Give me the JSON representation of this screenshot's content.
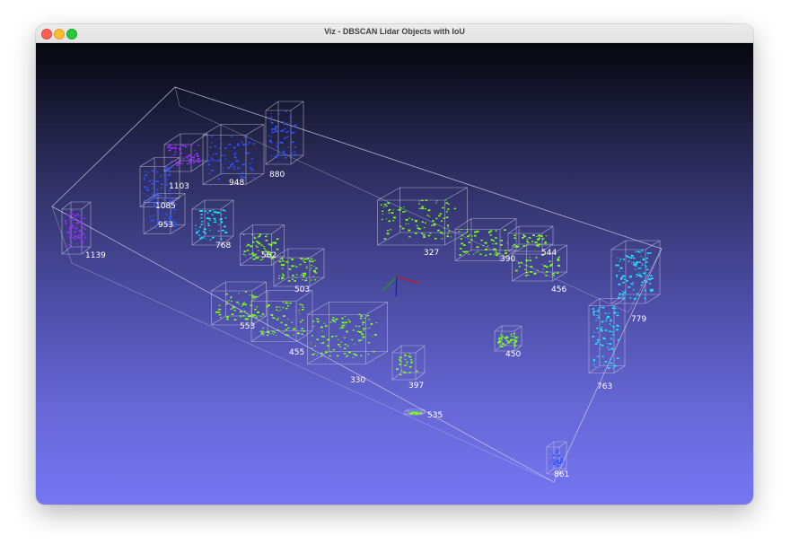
{
  "window": {
    "title": "Viz - DBSCAN Lidar Objects with IoU"
  },
  "colors": {
    "green": "#7dff1a",
    "cyan": "#1ee0ff",
    "blue": "#3050ff",
    "purple": "#9a2cff",
    "box": "#c8c8e0",
    "axis_x": "#d01818",
    "axis_y": "#18a018",
    "axis_z": "#1818d0"
  },
  "objects": [
    {
      "label": "1139",
      "color": "purple"
    },
    {
      "label": "1103",
      "color": "purple"
    },
    {
      "label": "1085",
      "color": "blue"
    },
    {
      "label": "953",
      "color": "blue"
    },
    {
      "label": "948",
      "color": "blue"
    },
    {
      "label": "880",
      "color": "blue"
    },
    {
      "label": "768",
      "color": "cyan"
    },
    {
      "label": "562",
      "color": "green"
    },
    {
      "label": "503",
      "color": "green"
    },
    {
      "label": "327",
      "color": "green"
    },
    {
      "label": "390",
      "color": "green"
    },
    {
      "label": "544",
      "color": "green"
    },
    {
      "label": "456",
      "color": "green"
    },
    {
      "label": "553",
      "color": "green"
    },
    {
      "label": "455",
      "color": "green"
    },
    {
      "label": "330",
      "color": "green"
    },
    {
      "label": "397",
      "color": "green"
    },
    {
      "label": "450",
      "color": "green"
    },
    {
      "label": "535",
      "color": "green"
    },
    {
      "label": "779",
      "color": "cyan"
    },
    {
      "label": "763",
      "color": "cyan"
    },
    {
      "label": "861",
      "color": "blue"
    }
  ]
}
